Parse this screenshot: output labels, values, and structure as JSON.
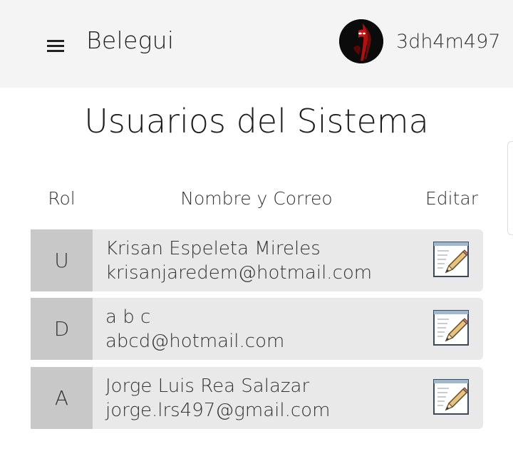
{
  "header": {
    "app_title": "Belegui",
    "username": "3dh4m497"
  },
  "page": {
    "title": "Usuarios del Sistema"
  },
  "table": {
    "columns": [
      "Rol",
      "Nombre y Correo",
      "Editar"
    ],
    "rows": [
      {
        "role": "U",
        "name": "Krisan Espeleta Mireles",
        "email": "krisanjaredem@hotmail.com"
      },
      {
        "role": "D",
        "name": "a b c",
        "email": "abcd@hotmail.com"
      },
      {
        "role": "A",
        "name": "Jorge Luis Rea Salazar",
        "email": "jorge.lrs497@gmail.com"
      }
    ]
  },
  "icons": {
    "menu": "hamburger-menu-icon",
    "edit": "edit-notepad-pencil-icon",
    "avatar": "user-avatar"
  },
  "colors": {
    "header_bg": "#f4f4f4",
    "row_bg": "#e9e9e9",
    "role_bg": "#c8c8c8"
  }
}
